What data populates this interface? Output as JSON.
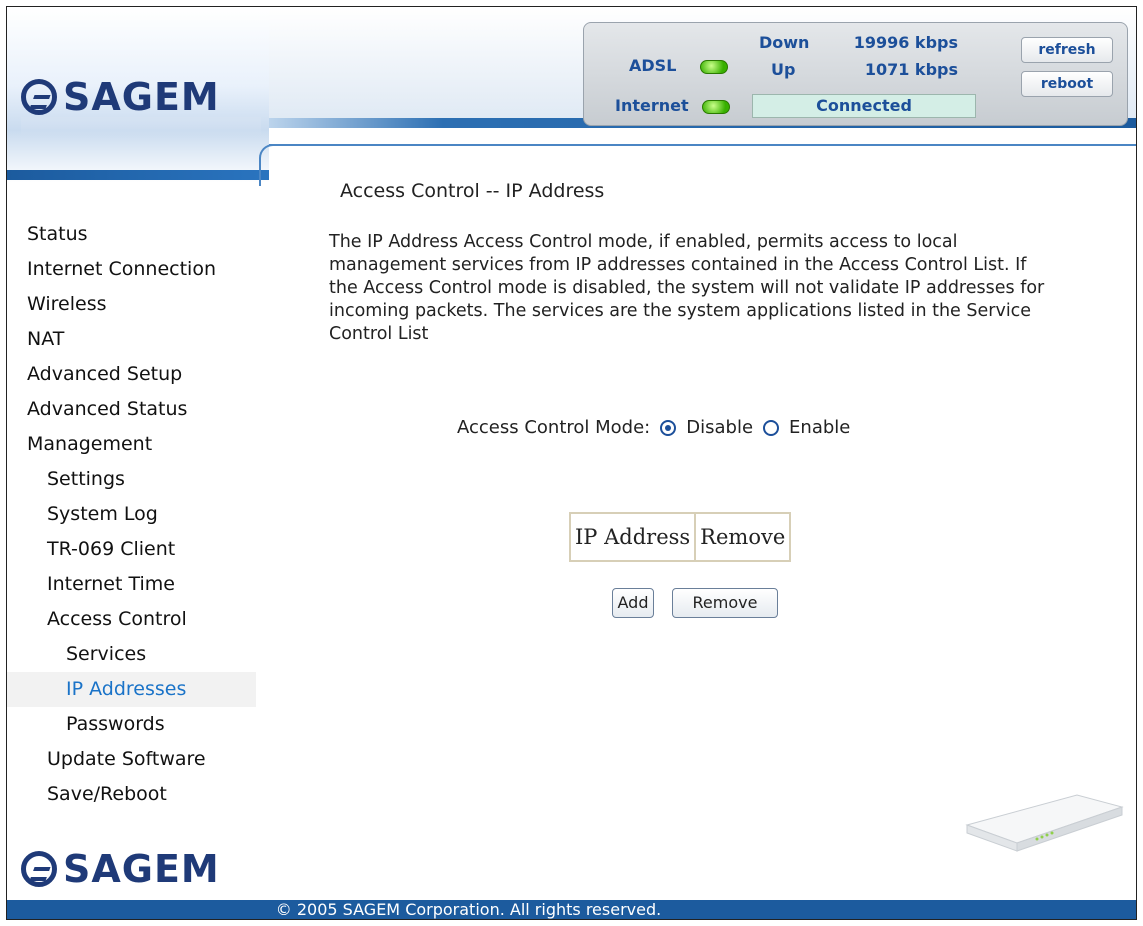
{
  "brand": {
    "logo_text": "SAGEM"
  },
  "status_bar": {
    "adsl_label": "ADSL",
    "internet_label": "Internet",
    "down_label": "Down",
    "down_value": "19996 kbps",
    "up_label": "Up",
    "up_value": "1071 kbps",
    "connection_status": "Connected",
    "refresh_label": "refresh",
    "reboot_label": "reboot",
    "led_color": "#38b000"
  },
  "sidebar": {
    "items": [
      {
        "label": "Status",
        "level": 0
      },
      {
        "label": "Internet Connection",
        "level": 0
      },
      {
        "label": "Wireless",
        "level": 0
      },
      {
        "label": "NAT",
        "level": 0
      },
      {
        "label": "Advanced Setup",
        "level": 0
      },
      {
        "label": "Advanced Status",
        "level": 0
      },
      {
        "label": "Management",
        "level": 0
      },
      {
        "label": "Settings",
        "level": 1
      },
      {
        "label": "System Log",
        "level": 1
      },
      {
        "label": "TR-069 Client",
        "level": 1
      },
      {
        "label": "Internet Time",
        "level": 1
      },
      {
        "label": "Access Control",
        "level": 1
      },
      {
        "label": "Services",
        "level": 2
      },
      {
        "label": "IP Addresses",
        "level": 2,
        "active": true
      },
      {
        "label": "Passwords",
        "level": 2
      },
      {
        "label": "Update Software",
        "level": 1
      },
      {
        "label": "Save/Reboot",
        "level": 1
      }
    ]
  },
  "main": {
    "title": "Access Control -- IP Address",
    "description": "The IP Address Access Control mode, if enabled, permits access to local management services from IP addresses contained in the Access Control List. If the Access Control mode is disabled, the system will not validate IP addresses for incoming packets. The services are the system applications listed in the Service Control List",
    "mode_label": "Access Control Mode:",
    "option_disable": "Disable",
    "option_enable": "Enable",
    "selected_mode": "Disable",
    "table_headers": [
      "IP Address",
      "Remove"
    ],
    "add_label": "Add",
    "remove_label": "Remove"
  },
  "footer": {
    "copyright": "© 2005 SAGEM Corporation. All rights reserved."
  },
  "colors": {
    "accent_blue": "#1c5b9e",
    "active_nav": "#1a73c8",
    "brand_navy": "#1f3a78"
  }
}
